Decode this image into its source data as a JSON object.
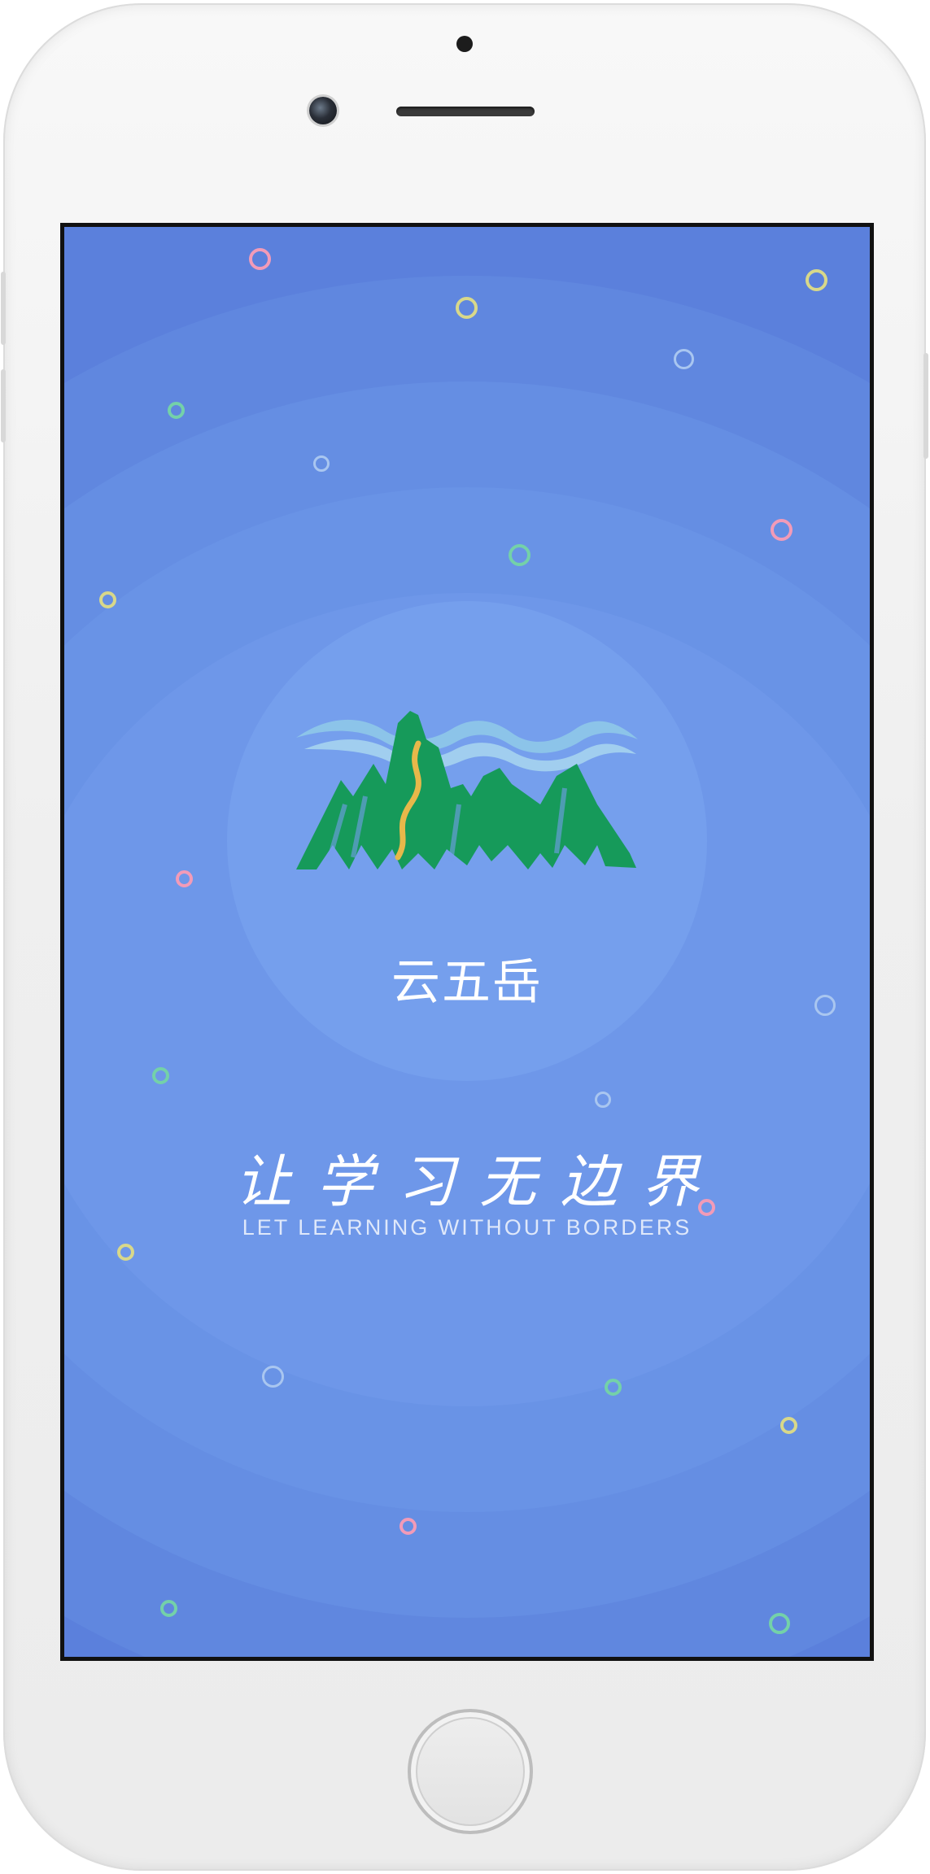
{
  "app": {
    "name": "云五岳",
    "slogan": "让学习无边界",
    "slogan_en": "LET LEARNING WITHOUT BORDERS"
  },
  "colors": {
    "screen_background": "#5b80dc",
    "mountain_green": "#169a5a",
    "water_blue": "#8fc8e8",
    "path_gold": "#e7b84a",
    "decor_circle_pink": "#f29bb8",
    "decor_circle_yellow": "#d8d88a",
    "decor_circle_green": "#74d1a9",
    "decor_circle_lightblue": "#a9c6f0"
  },
  "icons": {
    "logo": "mountain-logo-icon",
    "decorations": "ring-icon"
  }
}
